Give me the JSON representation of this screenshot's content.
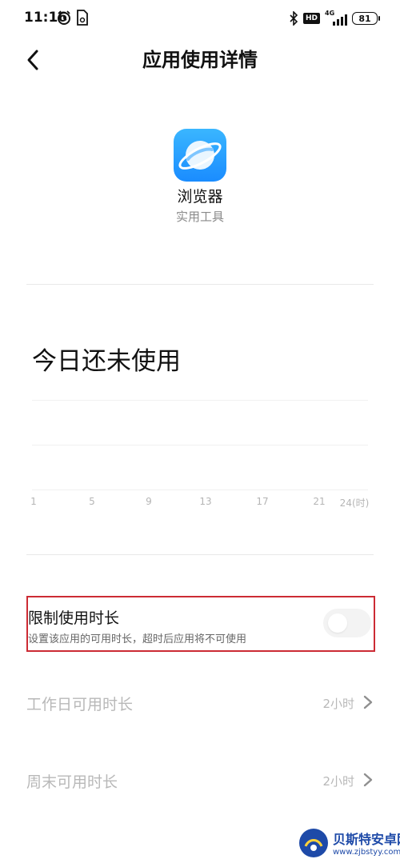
{
  "status_bar": {
    "time": "11:16",
    "hd_badge": "HD",
    "network": "4G",
    "battery": "81"
  },
  "header": {
    "title": "应用使用详情"
  },
  "app": {
    "name": "浏览器",
    "category": "实用工具",
    "icon": "browser-planet-icon"
  },
  "usage": {
    "title": "今日还未使用",
    "axis_ticks": [
      "1",
      "5",
      "9",
      "13",
      "17",
      "21",
      "24(时)"
    ]
  },
  "limit": {
    "title": "限制使用时长",
    "description": "设置该应用的可用时长，超时后应用将不可使用",
    "toggle_on": false
  },
  "rows": [
    {
      "label": "工作日可用时长",
      "value": "2小时"
    },
    {
      "label": "周末可用时长",
      "value": "2小时"
    }
  ],
  "watermark": {
    "title": "贝斯特安卓网",
    "url": "www.zjbstyy.com"
  },
  "colors": {
    "accent_red": "#cc2b34",
    "app_blue": "#1a8cff",
    "disabled_text": "#b8b8b8",
    "watermark_blue": "#1e4aa8"
  }
}
